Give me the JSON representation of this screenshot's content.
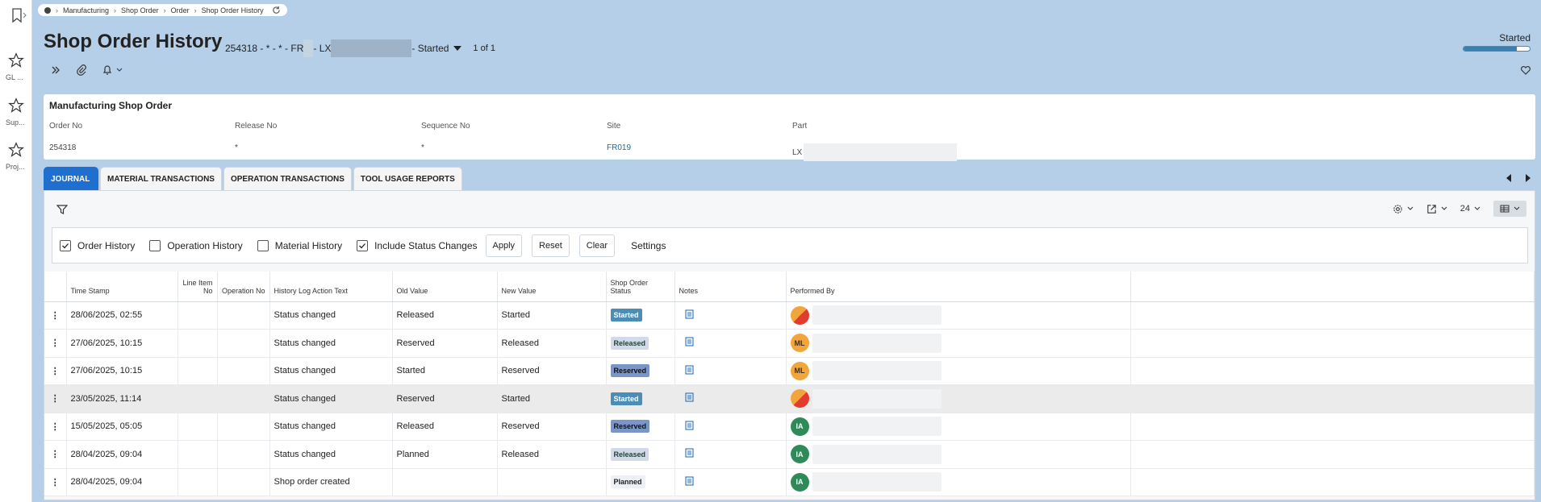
{
  "rail": {
    "items": [
      {
        "label": "GL ..."
      },
      {
        "label": "Sup..."
      },
      {
        "label": "Proj..."
      }
    ]
  },
  "breadcrumb": [
    "Manufacturing",
    "Shop Order",
    "Order",
    "Shop Order History"
  ],
  "page": {
    "title": "Shop Order History",
    "record_prefix": "254318 - * - * - FR",
    "record_mid": "- LX",
    "record_status": "- Started",
    "record_count": "1 of 1"
  },
  "status": {
    "label": "Started",
    "progress": 0.8
  },
  "header_card": {
    "title": "Manufacturing Shop Order",
    "fields": [
      {
        "label": "Order No",
        "value": "254318"
      },
      {
        "label": "Release No",
        "value": "*"
      },
      {
        "label": "Sequence No",
        "value": "*"
      },
      {
        "label": "Site",
        "value": "FR019"
      },
      {
        "label": "Part",
        "value": "LX"
      }
    ]
  },
  "tabs": [
    "JOURNAL",
    "MATERIAL TRANSACTIONS",
    "OPERATION TRANSACTIONS",
    "TOOL USAGE REPORTS"
  ],
  "panel": {
    "page_size": "24"
  },
  "options": {
    "checks": [
      {
        "label": "Order History",
        "checked": true
      },
      {
        "label": "Operation History",
        "checked": false
      },
      {
        "label": "Material History",
        "checked": false
      },
      {
        "label": "Include Status Changes",
        "checked": true
      }
    ],
    "apply": "Apply",
    "reset": "Reset",
    "clear": "Clear",
    "settings": "Settings"
  },
  "table": {
    "headers": [
      "Time Stamp",
      "Line Item No",
      "Operation No",
      "History Log Action Text",
      "Old Value",
      "New Value",
      "Shop Order Status",
      "Notes",
      "Performed By"
    ],
    "rows": [
      {
        "ts": "28/06/2025, 02:55",
        "action": "Status changed",
        "old": "Released",
        "new": "Started",
        "status": "Started",
        "avatar": ""
      },
      {
        "ts": "27/06/2025, 10:15",
        "action": "Status changed",
        "old": "Reserved",
        "new": "Released",
        "status": "Released",
        "avatar": "ML"
      },
      {
        "ts": "27/06/2025, 10:15",
        "action": "Status changed",
        "old": "Started",
        "new": "Reserved",
        "status": "Reserved",
        "avatar": "ML"
      },
      {
        "ts": "23/05/2025, 11:14",
        "action": "Status changed",
        "old": "Reserved",
        "new": "Started",
        "status": "Started",
        "avatar": ""
      },
      {
        "ts": "15/05/2025, 05:05",
        "action": "Status changed",
        "old": "Released",
        "new": "Reserved",
        "status": "Reserved",
        "avatar": "IA"
      },
      {
        "ts": "28/04/2025, 09:04",
        "action": "Status changed",
        "old": "Planned",
        "new": "Released",
        "status": "Released",
        "avatar": "IA"
      },
      {
        "ts": "28/04/2025, 09:04",
        "action": "Shop order created",
        "old": "",
        "new": "",
        "status": "Planned",
        "avatar": "IA"
      }
    ]
  },
  "colors": {
    "accent": "#1e6fd0",
    "background": "#b5cfe9"
  }
}
